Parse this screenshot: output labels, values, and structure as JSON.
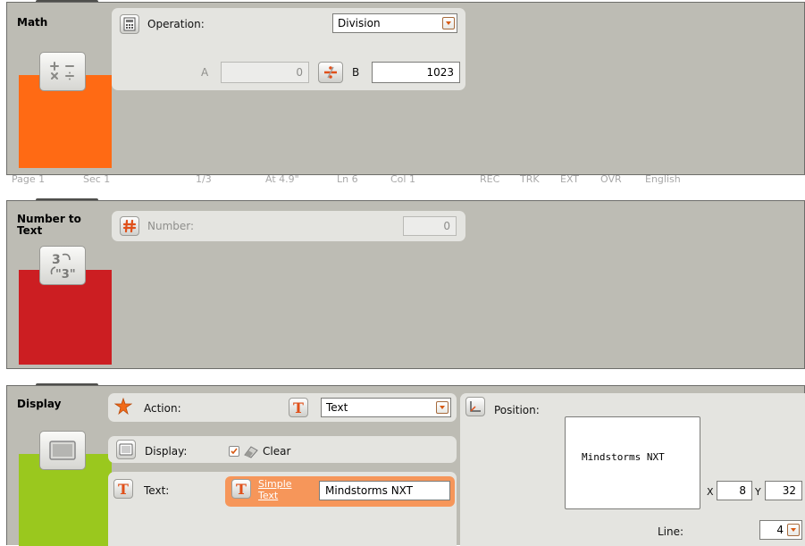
{
  "math": {
    "title": "Math",
    "color": "#ff6a14",
    "operation_label": "Operation:",
    "operation_value": "Division",
    "a_label": "A",
    "a_value": "0",
    "b_label": "B",
    "b_value": "1023",
    "icon": "calculator-icon",
    "op_symbol": "÷"
  },
  "number_to_text": {
    "title_line1": "Number to",
    "title_line2": "Text",
    "color": "#cc1e22",
    "number_label": "Number:",
    "number_value": "0",
    "icon": "hash-icon",
    "tile_top": "3",
    "tile_bottom": "\"3\""
  },
  "display": {
    "title": "Display",
    "color": "#9ac81e",
    "action_label": "Action:",
    "action_value": "Text",
    "display_label": "Display:",
    "clear_label": "Clear",
    "clear_checked": true,
    "text_label": "Text:",
    "simple_text_line1": "Simple",
    "simple_text_line2": "Text",
    "text_value": "Mindstorms NXT",
    "position_label": "Position:",
    "preview_text": "Mindstorms NXT",
    "x_label": "X",
    "x_value": "8",
    "y_label": "Y",
    "y_value": "32",
    "line_label": "Line:",
    "line_value": "4"
  },
  "background_strip": [
    "Page 1",
    "Sec 1",
    "1/3",
    "At 4.9\"",
    "Ln 6",
    "Col 1",
    "REC",
    "TRK",
    "EXT",
    "OVR",
    "English"
  ]
}
